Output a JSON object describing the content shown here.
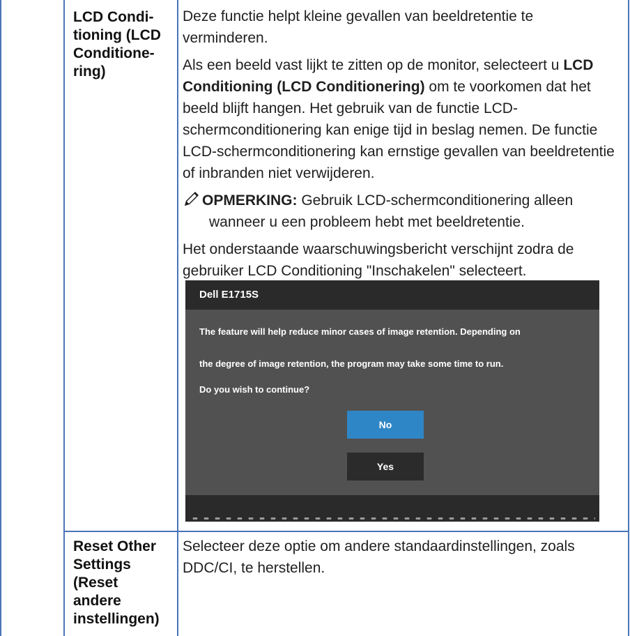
{
  "rows": [
    {
      "name_lines": [
        "LCD Condi-",
        "tioning (LCD",
        "Conditione-",
        "ring)"
      ],
      "description_1": "Deze functie helpt kleine gevallen van beeldretentie te verminderen.",
      "description_2_pre": "Als een beeld vast lijkt te zitten op de monitor, selecteert u",
      "description_2_bold": "LCD Conditioning (LCD Conditionering)",
      "description_2_post": "om te voorkomen dat het beeld blijft hangen. Het gebruik van de functie LCD-schermconditionering kan enige tijd in beslag nemen. De functie LCD-schermconditionering kan ernstige gevallen van beeldretentie of inbranden niet verwijderen.",
      "note_label": "OPMERKING:",
      "note_text_line1": "Gebruik LCD-schermconditionering alleen",
      "note_text_line2": "wanneer u een probleem hebt met beeldretentie.",
      "description_3": "Het onderstaande waarschuwingsbericht verschijnt zodra de gebruiker LCD Conditioning \"Inschakelen\" selecteert.",
      "osd": {
        "title": "Dell E1715S",
        "line1": "The feature will help reduce minor cases of image retention. Depending on",
        "line2": "the degree of image retention, the program may take some time to run.",
        "line3": "Do you wish to continue?",
        "no_label": "No",
        "yes_label": "Yes"
      }
    },
    {
      "name_lines": [
        "Reset Other",
        "Settings",
        "(Reset",
        "andere",
        "instellingen)"
      ],
      "description_1": "Selecteer deze optie om andere standaardinstellingen, zoals DDC/CI, te herstellen."
    }
  ],
  "colors": {
    "table_border": "#4a74b8",
    "osd_body": "#515151",
    "osd_bar": "#2a2a2a",
    "osd_no_button": "#2f86c6"
  },
  "icons": {
    "note": "pencil-note-icon"
  }
}
